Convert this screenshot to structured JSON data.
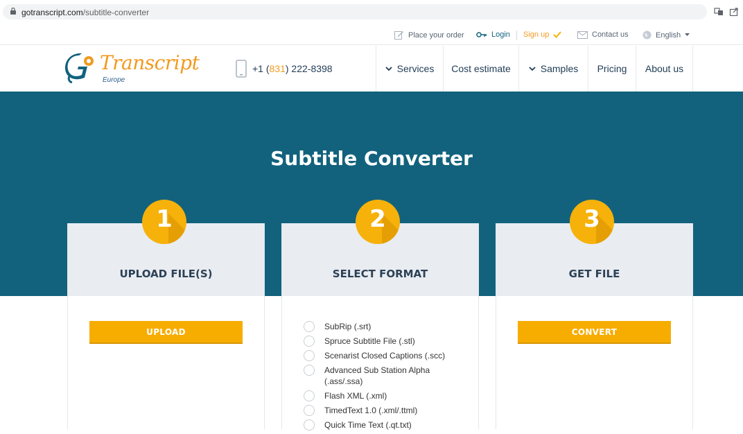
{
  "browser": {
    "url_domain": "gotranscript.com",
    "url_path": "/subtitle-converter",
    "translate_icon": "translate-icon",
    "share_icon": "share-icon"
  },
  "topbar": {
    "place_order": "Place your order",
    "login": "Login",
    "signup": "Sign up",
    "contact": "Contact us",
    "language": "English"
  },
  "header": {
    "logo_text": "Transcript",
    "logo_sub": "Europe",
    "phone_prefix": "+1 (",
    "phone_area": "831",
    "phone_rest": ") 222-8398",
    "nav": {
      "services": "Services",
      "cost_estimate": "Cost estimate",
      "samples": "Samples",
      "pricing": "Pricing",
      "about": "About us"
    }
  },
  "hero": {
    "title": "Subtitle Converter"
  },
  "steps": [
    {
      "number": "1",
      "label": "UPLOAD FILE(S)"
    },
    {
      "number": "2",
      "label": "SELECT FORMAT"
    },
    {
      "number": "3",
      "label": "GET FILE"
    }
  ],
  "upload_button": "UPLOAD",
  "convert_button": "CONVERT",
  "formats": [
    "SubRip (.srt)",
    "Spruce Subtitle File (.stl)",
    "Scenarist Closed Captions (.scc)",
    "Advanced Sub Station Alpha (.ass/.ssa)",
    "Flash XML (.xml)",
    "TimedText 1.0 (.xml/.ttml)",
    "Quick Time Text (.qt.txt)"
  ],
  "colors": {
    "hero_bg": "#12627d",
    "accent": "#f7ad00",
    "brand_orange": "#f19a1f",
    "card_head": "#e9ecf1"
  }
}
